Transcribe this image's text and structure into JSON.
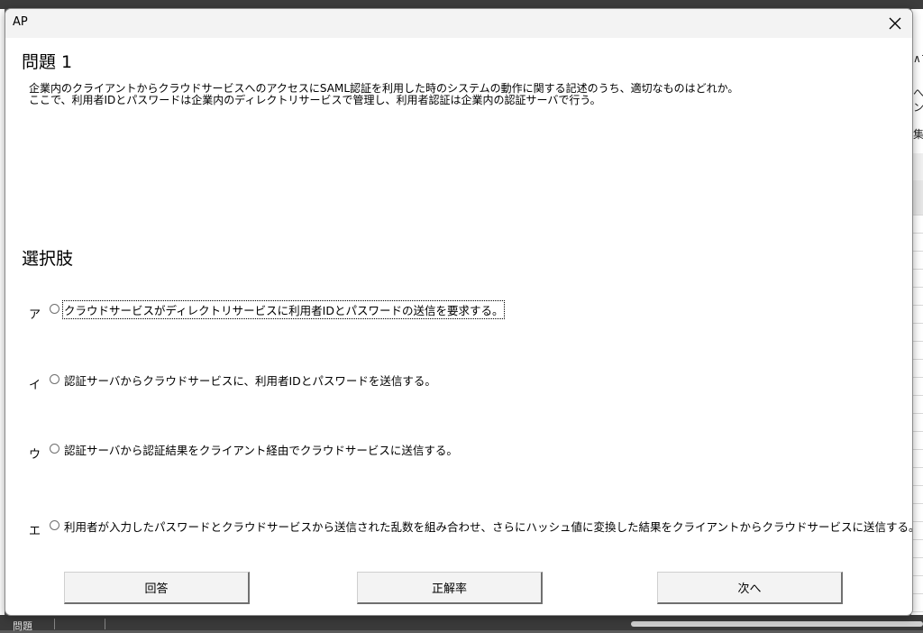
{
  "window": {
    "title": "AP"
  },
  "question": {
    "heading": "問題 1",
    "lines": [
      "企業内のクライアントからクラウドサービスへのアクセスにSAML認証を利用した時のシステムの動作に関する記述のうち、適切なものはどれか。",
      "ここで、利用者IDとパスワードは企業内のディレクトリサービスで管理し、利用者認証は企業内の認証サーバで行う。"
    ]
  },
  "choices": {
    "heading": "選択肢",
    "items": [
      {
        "letter": "ア",
        "text": "クラウドサービスがディレクトリサービスに利用者IDとパスワードの送信を要求する。"
      },
      {
        "letter": "イ",
        "text": "認証サーバからクラウドサービスに、利用者IDとパスワードを送信する。"
      },
      {
        "letter": "ウ",
        "text": "認証サーバから認証結果をクライアント経由でクラウドサービスに送信する。"
      },
      {
        "letter": "エ",
        "text": "利用者が入力したパスワードとクラウドサービスから送信された乱数を組み合わせ、さらにハッシュ値に変換した結果をクライアントからクラウドサービスに送信する。"
      }
    ]
  },
  "buttons": {
    "answer": "回答",
    "accuracy": "正解率",
    "next": "次へ"
  },
  "background": {
    "sheet_tab": "問題",
    "right_fragments": [
      "∧マ",
      "へ替",
      "ンタ",
      "集"
    ]
  },
  "icons": {
    "close": "close-icon",
    "radio": "radio-button"
  }
}
